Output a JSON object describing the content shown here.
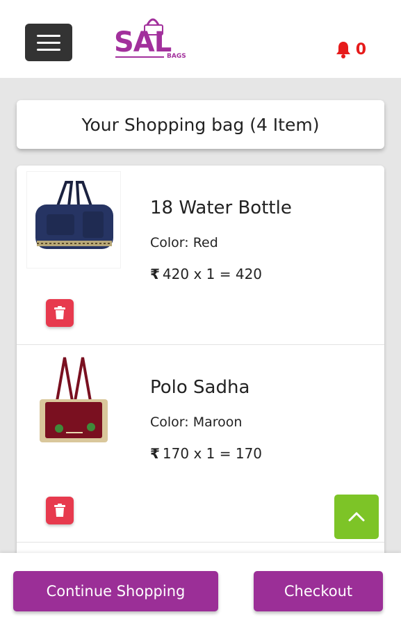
{
  "header": {
    "logo_text": "SAL",
    "logo_sub": "BAGS",
    "notification_count": "0"
  },
  "cart": {
    "title": "Your Shopping bag (4 Item)",
    "items": [
      {
        "name": "18 Water Bottle",
        "color": "Color: Red",
        "price": "420 x 1 = 420",
        "currency": "₹"
      },
      {
        "name": "Polo Sadha",
        "color": "Color: Maroon",
        "price": "170 x 1 = 170",
        "currency": "₹"
      }
    ]
  },
  "footer": {
    "continue_label": "Continue Shopping",
    "checkout_label": "Checkout"
  },
  "colors": {
    "brand": "#9b2f97",
    "delete": "#e73a4e",
    "scroll_top": "#7dc427",
    "notification": "#e61b1b"
  }
}
